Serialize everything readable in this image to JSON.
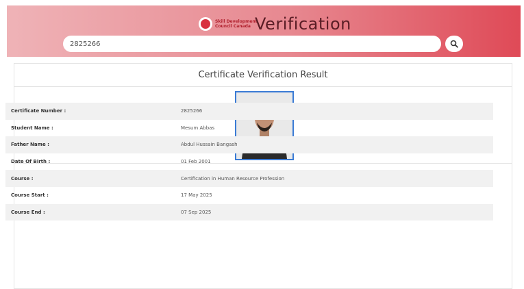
{
  "header": {
    "logo_line1": "Skill Development",
    "logo_line2": "Council Canada",
    "title": "Verification",
    "search_value": "2825266"
  },
  "colors": {
    "header_start": "#efb3b7",
    "header_end": "#df4a57",
    "photo_border": "#3a7bd5"
  },
  "icons": {
    "search": "search-icon"
  },
  "card": {
    "title": "Certificate Verification Result",
    "rows": [
      {
        "label": "Certificate Number :",
        "value": "2825266"
      },
      {
        "label": "Student Name :",
        "value": "Mesum Abbas"
      },
      {
        "label": "Father Name :",
        "value": "Abdul Hussain Bangash"
      },
      {
        "label": "Date Of Birth :",
        "value": "01 Feb 2001"
      },
      {
        "label": "Course :",
        "value": "Certification in Human Resource Profession"
      },
      {
        "label": "Course Start :",
        "value": "17 May 2025"
      },
      {
        "label": "Course End :",
        "value": "07 Sep 2025"
      }
    ]
  }
}
